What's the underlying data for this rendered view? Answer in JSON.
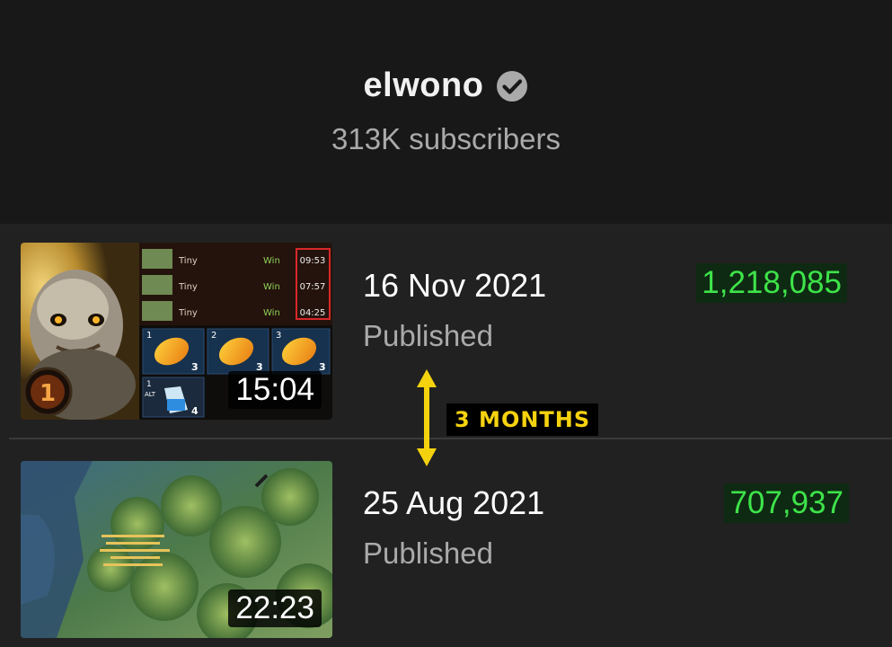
{
  "channel": {
    "name": "elwono",
    "verified_icon": "verified-check-icon",
    "subscribers": "313K subscribers"
  },
  "videos": [
    {
      "duration": "15:04",
      "date": "16 Nov 2021",
      "status": "Published",
      "views": "1,218,085",
      "thumbnail": {
        "scoreboard": [
          {
            "hero": "Tiny",
            "result": "Win",
            "time": "09:53"
          },
          {
            "hero": "Tiny",
            "result": "Win",
            "time": "07:57"
          },
          {
            "hero": "Tiny",
            "result": "Win",
            "time": "04:25"
          }
        ],
        "inventory_slots": [
          "1",
          "2",
          "3"
        ],
        "inventory_counts": [
          "3",
          "3",
          "3"
        ],
        "alt_slot": "ALT",
        "alt_slot_number": "1",
        "alt_count": "4",
        "level": "1"
      }
    },
    {
      "duration": "22:23",
      "date": "25 Aug 2021",
      "status": "Published",
      "views": "707,937"
    }
  ],
  "gap_annotation": {
    "label": "3 MONTHS",
    "color": "#f5d20e"
  },
  "colors": {
    "views_text": "#3ee34a",
    "views_bg": "#0e2a12",
    "background": "#181818",
    "list_background": "#212121"
  }
}
